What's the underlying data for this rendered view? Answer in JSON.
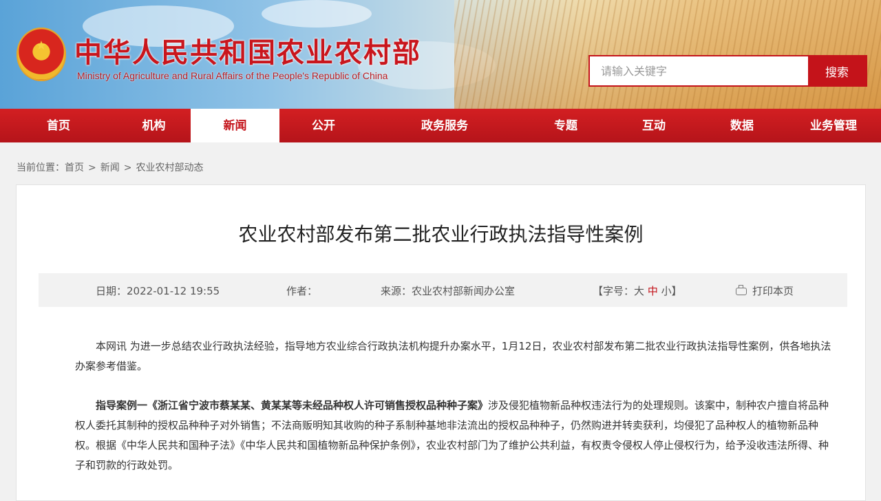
{
  "header": {
    "site_title": "中华人民共和国农业农村部",
    "site_subtitle": "Ministry of Agriculture and Rural Affairs of the People's Republic of China",
    "search_placeholder": "请输入关键字",
    "search_button": "搜索"
  },
  "nav": {
    "items": [
      {
        "label": "首页"
      },
      {
        "label": "机构"
      },
      {
        "label": "新闻"
      },
      {
        "label": "公开"
      },
      {
        "label": "政务服务"
      },
      {
        "label": "专题"
      },
      {
        "label": "互动"
      },
      {
        "label": "数据"
      },
      {
        "label": "业务管理"
      }
    ],
    "active": "新闻"
  },
  "breadcrumb": {
    "prefix": "当前位置：",
    "items": [
      "首页",
      "新闻",
      "农业农村部动态"
    ]
  },
  "article": {
    "title": "农业农村部发布第二批农业行政执法指导性案例",
    "meta": {
      "date_label": "日期：",
      "date": "2022-01-12 19:55",
      "author_label": "作者：",
      "source_label": "来源：",
      "source": "农业农村部新闻办公室",
      "font_size_label": "【字号：",
      "font_large": "大",
      "font_medium": "中",
      "font_small": "小",
      "font_close": "】",
      "print_label": "打印本页"
    },
    "paragraph1": "本网讯 为进一步总结农业行政执法经验，指导地方农业综合行政执法机构提升办案水平，1月12日，农业农村部发布第二批农业行政执法指导性案例，供各地执法办案参考借鉴。",
    "paragraph2_title": "指导案例一《浙江省宁波市蔡某某、黄某某等未经品种权人许可销售授权品种种子案》",
    "paragraph2_body": "涉及侵犯植物新品种权违法行为的处理规则。该案中，制种农户擅自将品种权人委托其制种的授权品种种子对外销售；不法商贩明知其收购的种子系制种基地非法流出的授权品种种子，仍然购进并转卖获利，均侵犯了品种权人的植物新品种权。根据《中华人民共和国种子法》《中华人民共和国植物新品种保护条例》，农业农村部门为了维护公共利益，有权责令侵权人停止侵权行为，给予没收违法所得、种子和罚款的行政处罚。"
  },
  "colors": {
    "brand_red": "#c4131a",
    "nav_red": "#d31f22",
    "active_font": "#c4131a"
  }
}
